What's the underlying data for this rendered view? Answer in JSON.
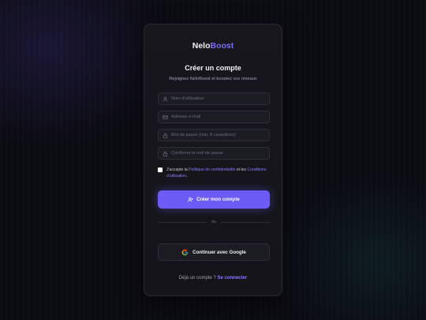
{
  "brand": {
    "name_part1": "Nelo",
    "name_part2": "Boost"
  },
  "header": {
    "title": "Créer un compte",
    "subtitle": "Rejoignez NeloBoost et boostez vos réseaux"
  },
  "form": {
    "username_placeholder": "Nom d'utilisateur",
    "email_placeholder": "Adresse e-mail",
    "password_placeholder": "Mot de passe (min. 8 caractères)",
    "confirm_placeholder": "Confirmer le mot de passe",
    "terms_prefix": "J'accepte la ",
    "privacy_link": "Politique de confidentialité",
    "terms_middle": " et les ",
    "conditions_link": "Conditions d'utilisation",
    "terms_suffix": ".",
    "terms_checked": false,
    "submit_label": "Créer mon compte"
  },
  "divider_label": "ou",
  "google_label": "Continuer avec Google",
  "footer": {
    "prompt": "Déjà un compte ? ",
    "login_link": "Se connecter"
  },
  "colors": {
    "accent": "#6b5cf6",
    "link": "#8a7cff",
    "card_bg": "#17171d",
    "page_bg": "#0b0b12"
  },
  "icons": {
    "username": "user-icon",
    "email": "mail-icon",
    "password": "lock-icon",
    "confirm": "lock-icon",
    "submit": "user-plus-icon",
    "google": "google-icon"
  }
}
